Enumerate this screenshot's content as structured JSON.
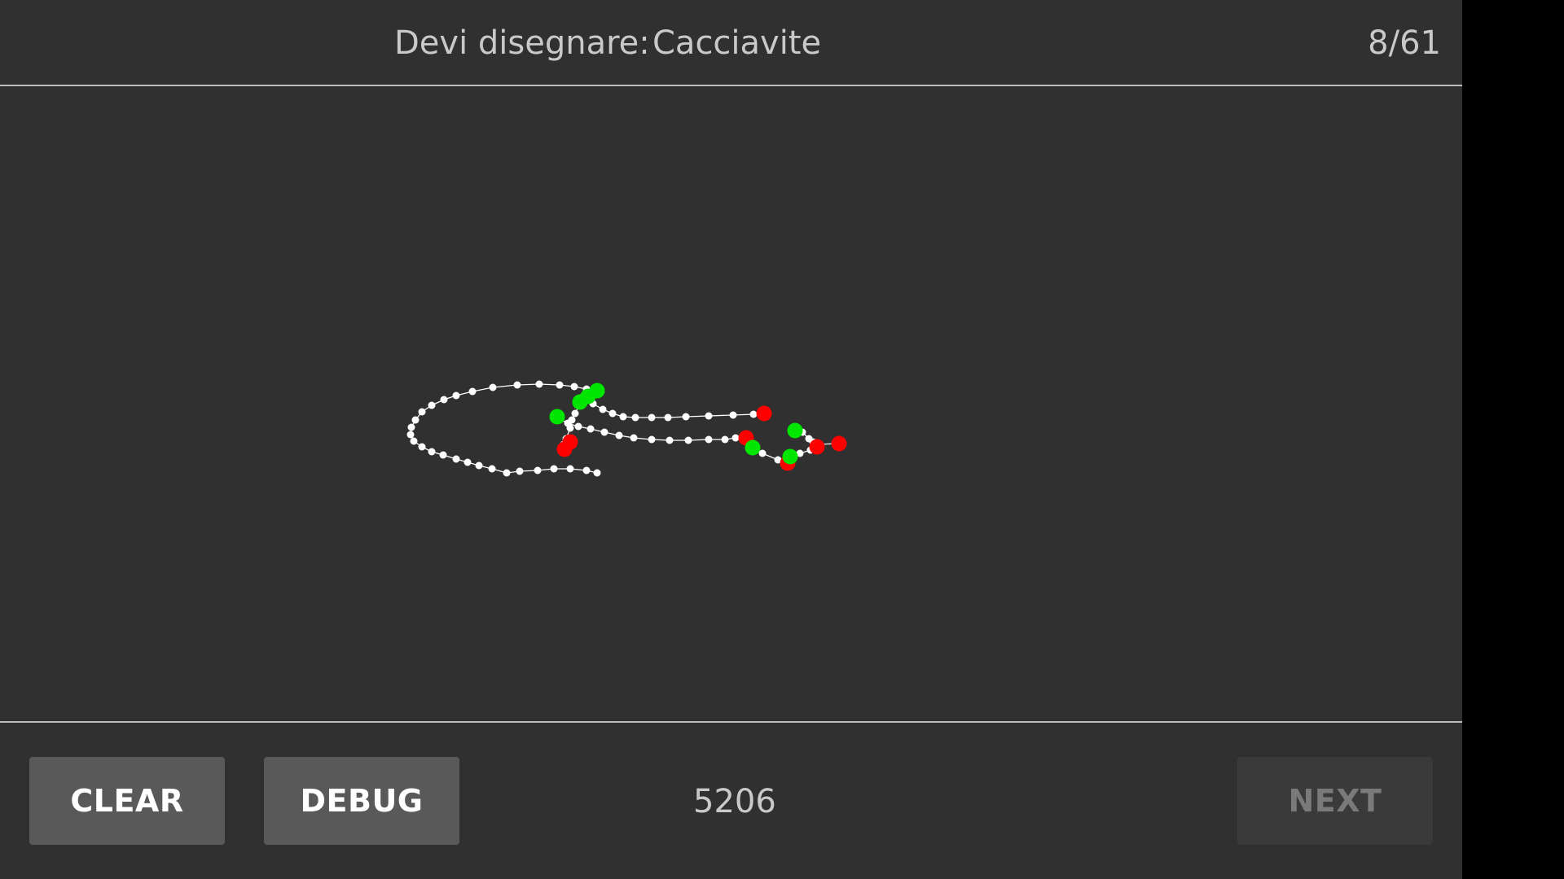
{
  "header": {
    "prompt_label": "Devi disegnare:",
    "prompt_word": "Cacciavite",
    "progress": "8/61"
  },
  "footer": {
    "clear_label": "CLEAR",
    "debug_label": "DEBUG",
    "counter": "5206",
    "next_label": "NEXT"
  },
  "colors": {
    "background": "#303030",
    "stroke": "#ffffff",
    "start_marker": "#00e600",
    "end_marker": "#ff0000"
  }
}
